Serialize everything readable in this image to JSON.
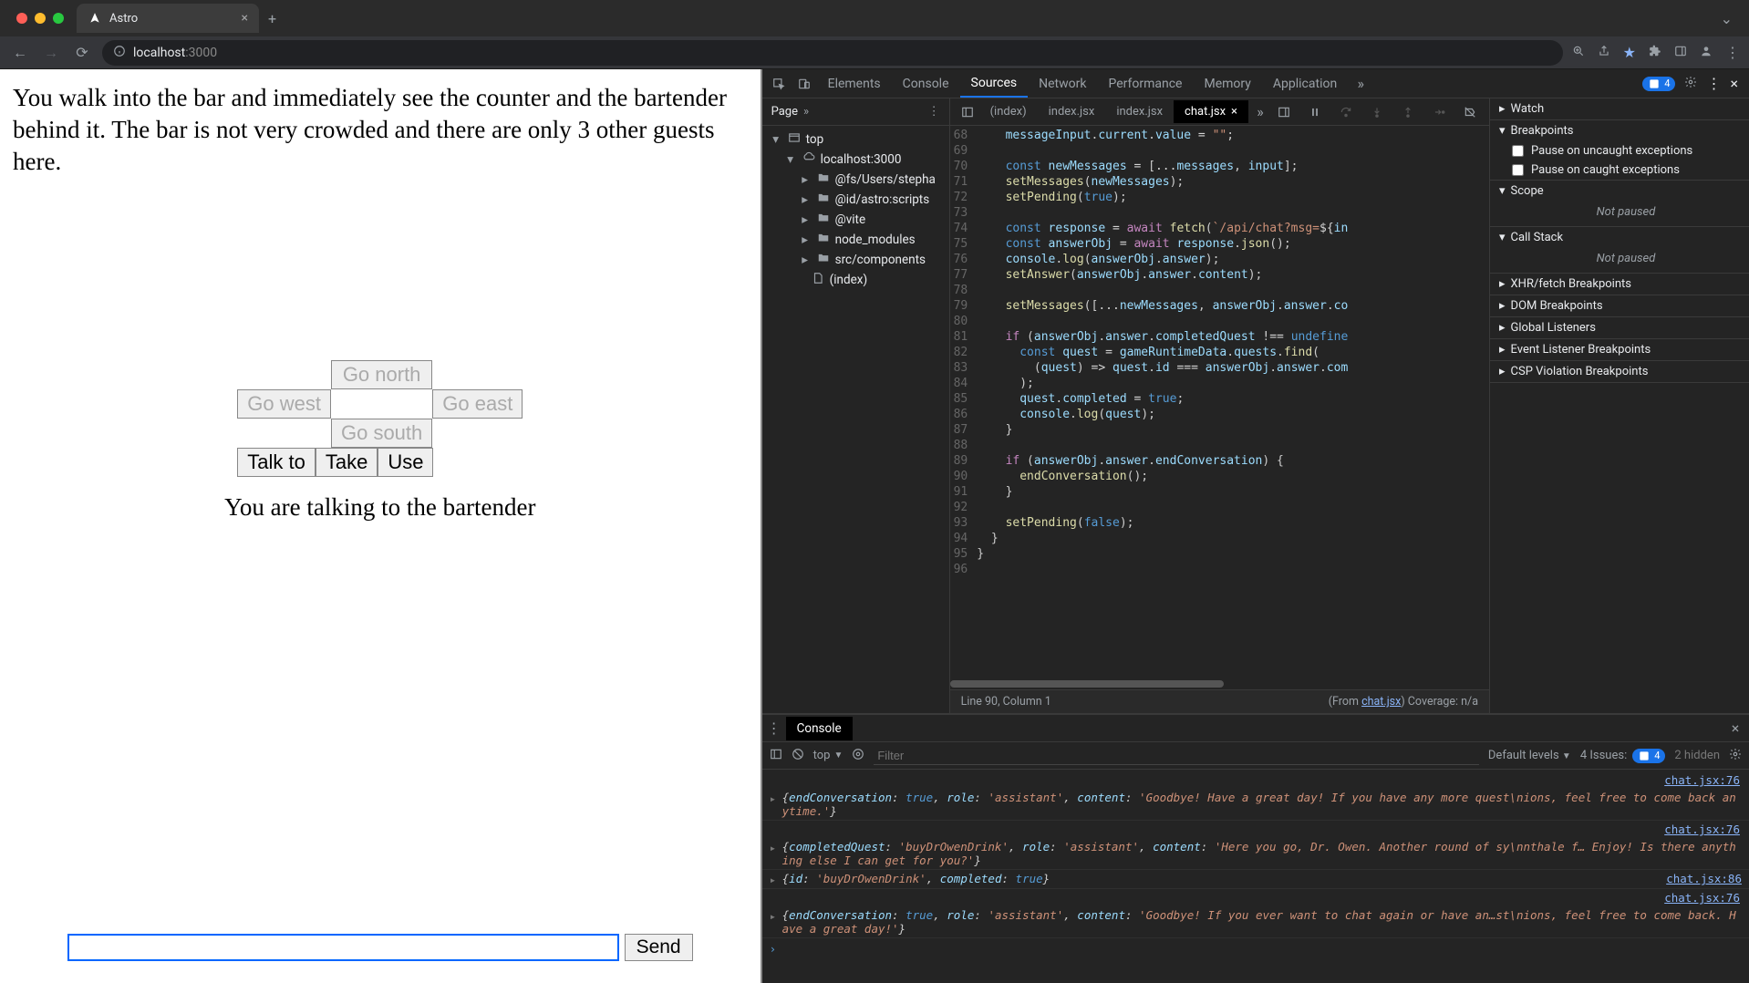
{
  "browser": {
    "tab_title": "Astro",
    "url_host": "localhost",
    "url_port": ":3000"
  },
  "game": {
    "description": "You walk into the bar and immediately see the counter and the bartender behind it. The bar is not very crowded and there are only 3 other guests here.",
    "actions": {
      "talk": "Talk to",
      "take": "Take",
      "use": "Use"
    },
    "directions": {
      "north": "Go north",
      "west": "Go west",
      "east": "Go east",
      "south": "Go south"
    },
    "status": "You are talking to the bartender",
    "send": "Send"
  },
  "devtools": {
    "tabs": {
      "elements": "Elements",
      "console": "Console",
      "sources": "Sources",
      "network": "Network",
      "performance": "Performance",
      "memory": "Memory",
      "application": "Application"
    },
    "issue_count": "4",
    "navigator": {
      "tab": "Page",
      "tree": {
        "top": "top",
        "host": "localhost:3000",
        "fs": "@fs/Users/stepha",
        "astro": "@id/astro:scripts",
        "vite": "@vite",
        "nm": "node_modules",
        "src": "src/components",
        "index": "(index)"
      }
    },
    "editor": {
      "tabs": {
        "t0": "(index)",
        "t1": "index.jsx",
        "t2": "index.jsx",
        "t3": "chat.jsx"
      },
      "status_left": "Line 90, Column 1",
      "status_from": "(From ",
      "status_link": "chat.jsx",
      "status_right": ") Coverage: n/a"
    },
    "debugger": {
      "sections": {
        "watch": "Watch",
        "breakpoints": "Breakpoints",
        "scope": "Scope",
        "callstack": "Call Stack",
        "xhr": "XHR/fetch Breakpoints",
        "dom": "DOM Breakpoints",
        "global": "Global Listeners",
        "event": "Event Listener Breakpoints",
        "csp": "CSP Violation Breakpoints"
      },
      "not_paused": "Not paused",
      "chk_uncaught": "Pause on uncaught exceptions",
      "chk_caught": "Pause on caught exceptions"
    },
    "console": {
      "tab": "Console",
      "context": "top",
      "filter_ph": "Filter",
      "levels": "Default levels",
      "issues_label": "4 Issues:",
      "issues_badge": "4",
      "hidden": "2 hidden",
      "links": {
        "l76": "chat.jsx:76",
        "l86": "chat.jsx:86"
      }
    }
  },
  "code_lines": [
    "68",
    "69",
    "70",
    "71",
    "72",
    "73",
    "74",
    "75",
    "76",
    "77",
    "78",
    "79",
    "80",
    "81",
    "82",
    "83",
    "84",
    "85",
    "86",
    "87",
    "88",
    "89",
    "90",
    "91",
    "92",
    "93",
    "94",
    "95",
    "96"
  ]
}
